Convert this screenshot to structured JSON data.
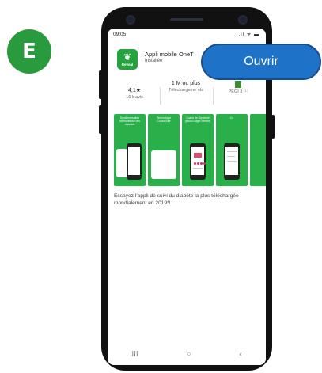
{
  "step_label": "E",
  "status_bar": {
    "time": "09:05",
    "icons_text": "..ıl ᯤ ▬"
  },
  "app": {
    "name": "Appli mobile OneT",
    "status": "Installée",
    "icon_brand": "Reveal",
    "open_button_label": "Ouvrir"
  },
  "stats": {
    "rating": {
      "value": "4,1★",
      "label": "16 k avis"
    },
    "downloads": {
      "value": "1 M ou plus",
      "label": "Téléchargeme nts"
    },
    "pegi": {
      "label": "PEGI 3 ⓘ"
    }
  },
  "screenshots": [
    {
      "caption": "Synchronisation harmonieuse des résultats"
    },
    {
      "caption": "Technologie ColourSure"
    },
    {
      "caption": "Coach de Glycémie (Blood Sugar Mentor)"
    },
    {
      "caption": "Co"
    }
  ],
  "description": "Essayez l’appli de suivi du diabète la plus téléchargée mondialement en 2019*!",
  "nav": {
    "recent": "III",
    "home": "○",
    "back": "‹"
  },
  "colors": {
    "green": "#29b04a",
    "button_blue": "#1e72c8",
    "badge_green": "#2a9a3e"
  }
}
